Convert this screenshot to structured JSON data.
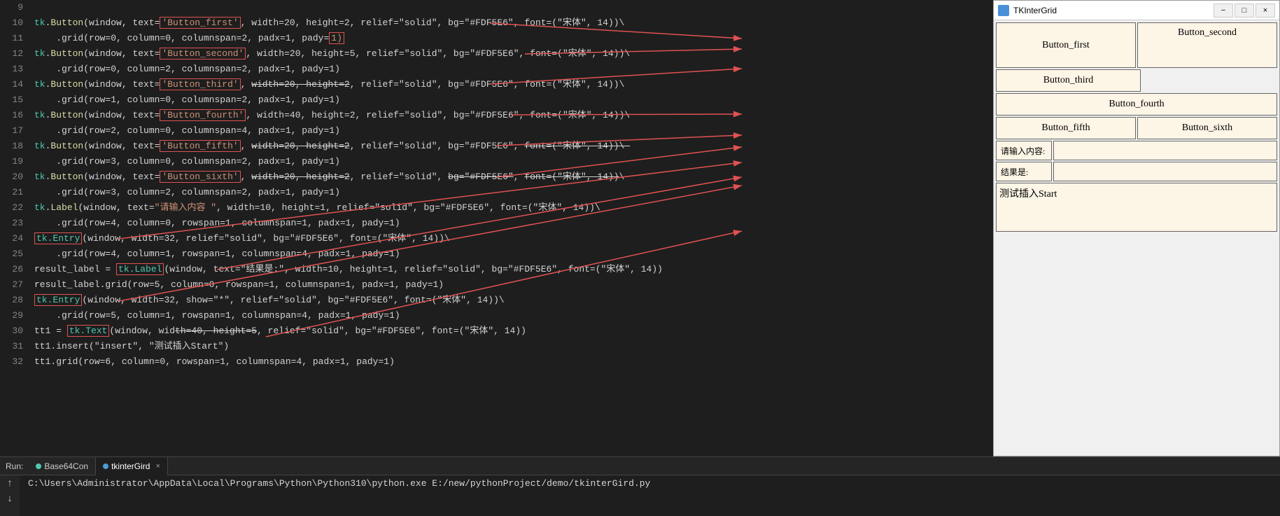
{
  "window_title": "TKInterGrid",
  "code_lines": [
    {
      "num": "9",
      "content": ""
    },
    {
      "num": "10",
      "content": "tk.Button(window, text=‘Button_first’, width=20, height=2, relief=\"solid\", bg=\"#FDF5E6\", font=(\"宋体\", 14))\\"
    },
    {
      "num": "11",
      "content": "    .grid(row=0, column=0, columnspan=2, padx=1, pady=1)"
    },
    {
      "num": "12",
      "content": "tk.Button(window, text=‘Button_second’, width=20, height=5, relief=\"solid\", bg=\"#FDF5E6\", font=(\"宋体\", 14))\\"
    },
    {
      "num": "13",
      "content": "    .grid(row=0, column=2, columnspan=2, padx=1, pady=1)"
    },
    {
      "num": "14",
      "content": "tk.Button(window, text=‘Button_third’, width=20, height=2, relief=\"solid\", bg=\"#FDF5E6\", font=(\"宋体\", 14))\\"
    },
    {
      "num": "15",
      "content": "    .grid(row=1, column=0, columnspan=2, padx=1, pady=1)"
    },
    {
      "num": "16",
      "content": "tk.Button(window, text=‘Button_fourth’, width=40, height=2, relief=\"solid\", bg=\"#FDF5E6\", font=(\"宋体\", 14))\\"
    },
    {
      "num": "17",
      "content": "    .grid(row=2, column=0, columnspan=4, padx=1, pady=1)"
    },
    {
      "num": "18",
      "content": "tk.Button(window, text=‘Button_fifth’, width=20, height=2, relief=\"solid\", bg=\"#FDF5E6\", font=(\"宋体\", 14))\\"
    },
    {
      "num": "19",
      "content": "    .grid(row=3, column=0, columnspan=2, padx=1, pady=1)"
    },
    {
      "num": "20",
      "content": "tk.Button(window, text=‘Button_sixth’, width=20, height=2, relief=\"solid\", bg=\"#FDF5E6\", font=(\"宋体\", 14))\\"
    },
    {
      "num": "21",
      "content": "    .grid(row=3, column=2, columnspan=2, padx=1, pady=1)"
    },
    {
      "num": "22",
      "content": "tk.Label(window, text=\"请输入内容 \", width=10, height=1, relief=\"solid\", bg=\"#FDF5E6\", font=(\"宋体\", 14))\\"
    },
    {
      "num": "23",
      "content": "    .grid(row=4, column=0, rowspan=1, columnspan=1, padx=1, pady=1)"
    },
    {
      "num": "24",
      "content": "tk.Entry(window, width=32, relief=\"solid\", bg=\"#FDF5E6\", font=(\"宋体\", 14))\\"
    },
    {
      "num": "25",
      "content": "    .grid(row=4, column=1, rowspan=1, columnspan=4, padx=1, pady=1)"
    },
    {
      "num": "26",
      "content": "result_label = tk.Label(window, text=\"结果是:\", width=10, height=1, relief=\"solid\", bg=\"#FDF5E6\", font=(\"宋体\", 14))"
    },
    {
      "num": "27",
      "content": "result_label.grid(row=5, column=0, rowspan=1, columnspan=1, padx=1, pady=1)"
    },
    {
      "num": "28",
      "content": "tk.Entry(window, width=32, show=\"*\", relief=\"solid\", bg=\"#FDF5E6\", font=(\"宋体\", 14))\\"
    },
    {
      "num": "29",
      "content": "    .grid(row=5, column=1, rowspan=1, columnspan=4, padx=1, pady=1)"
    },
    {
      "num": "30",
      "content": "tt1 = tk.Text(window, width=40, height=5, relief=\"solid\", bg=\"#FDF5E6\", font=(\"宋体\", 14))"
    },
    {
      "num": "31",
      "content": "tt1.insert(\"insert\", \"测试插入Start\")"
    },
    {
      "num": "32",
      "content": "tt1.grid(row=6, column=0, rowspan=1, columnspan=4, padx=1, pady=1)"
    }
  ],
  "tk_window": {
    "title": "TKInterGrid",
    "controls": {
      "minimize": "−",
      "maximize": "□",
      "close": "×"
    },
    "buttons": {
      "first": "Button_first",
      "second": "Button_second",
      "third": "Button_third",
      "fourth": "Button_fourth",
      "fifth": "Button_fifth",
      "sixth": "Button_sixth"
    },
    "label_input": "请输入内容:",
    "label_result": "结果是:",
    "text_content": "测试插入Start"
  },
  "bottom_panel": {
    "run_label": "Run:",
    "tabs": [
      {
        "label": "Base64Con",
        "active": false,
        "color": "#4ec9b0"
      },
      {
        "label": "tkinterGird",
        "active": true,
        "color": "#4a9cd4"
      }
    ],
    "terminal_line": "C:\\Users\\Administrator\\AppData\\Local\\Programs\\Python\\Python310\\python.exe E:/new/pythonProject/demo/tkinterGird.py",
    "scroll_up": "↑",
    "scroll_down": "↓"
  }
}
